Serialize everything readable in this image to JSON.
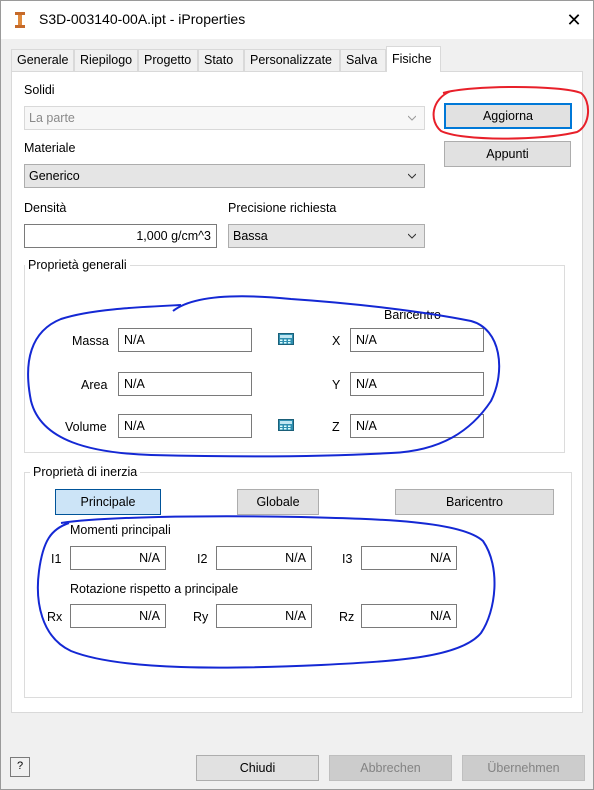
{
  "window": {
    "title": "S3D-003140-00A.ipt - iProperties",
    "close": "✕"
  },
  "tabs": [
    {
      "label": "Generale"
    },
    {
      "label": "Riepilogo"
    },
    {
      "label": "Progetto"
    },
    {
      "label": "Stato"
    },
    {
      "label": "Personalizzate"
    },
    {
      "label": "Salva"
    },
    {
      "label": "Fisiche",
      "active": true
    }
  ],
  "solids": {
    "label": "Solidi",
    "value": "La parte"
  },
  "material": {
    "label": "Materiale",
    "value": "Generico"
  },
  "density": {
    "label": "Densità",
    "value": "1,000 g/cm^3"
  },
  "precision": {
    "label": "Precisione richiesta",
    "value": "Bassa"
  },
  "buttons": {
    "update": "Aggiorna",
    "clipboard": "Appunti"
  },
  "general": {
    "title": "Proprietà generali",
    "centroid_label": "Baricentro",
    "mass_label": "Massa",
    "mass": "N/A",
    "area_label": "Area",
    "area": "N/A",
    "volume_label": "Volume",
    "volume": "N/A",
    "x_label": "X",
    "x": "N/A",
    "y_label": "Y",
    "y": "N/A",
    "z_label": "Z",
    "z": "N/A"
  },
  "inertia": {
    "title": "Proprietà di inerzia",
    "buttons": {
      "principal": "Principale",
      "global": "Globale",
      "centroid": "Baricentro"
    },
    "moments_label": "Momenti principali",
    "i1_label": "I1",
    "i1": "N/A",
    "i2_label": "I2",
    "i2": "N/A",
    "i3_label": "I3",
    "i3": "N/A",
    "rotation_label": "Rotazione rispetto a principale",
    "rx_label": "Rx",
    "rx": "N/A",
    "ry_label": "Ry",
    "ry": "N/A",
    "rz_label": "Rz",
    "rz": "N/A"
  },
  "footer": {
    "help": "?",
    "close": "Chiudi",
    "cancel": "Abbrechen",
    "apply": "Übernehmen"
  },
  "colors": {
    "annotation_red": "#e8202a",
    "annotation_blue": "#1428d4",
    "focus": "#0078d7"
  }
}
